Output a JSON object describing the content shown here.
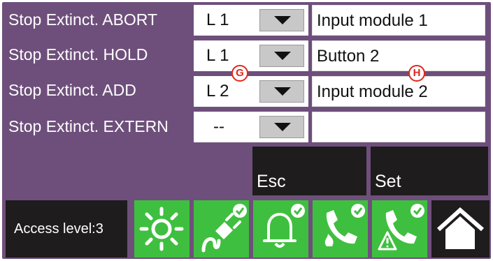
{
  "rows": [
    {
      "label": "Stop Extinct. ABORT",
      "value": "L 1",
      "description": "Input module 1"
    },
    {
      "label": "Stop Extinct. HOLD",
      "value": "L 1",
      "description": "Button 2"
    },
    {
      "label": "Stop Extinct. ADD",
      "value": "L 2",
      "description": "Input module 2"
    },
    {
      "label": "Stop Extinct. EXTERN",
      "value": "--",
      "description": ""
    }
  ],
  "markers": {
    "g": "G",
    "h": "H"
  },
  "buttons": {
    "esc": "Esc",
    "set": "Set"
  },
  "footer": {
    "access_level": "Access level:3"
  },
  "status_icons": [
    "sun-icon",
    "power-plug-icon",
    "bell-icon",
    "phone-fire-icon",
    "phone-warning-icon",
    "home-icon"
  ],
  "colors": {
    "panel": "#6e4f7b",
    "status_green": "#3fbf3f",
    "dark": "#1f1c1d",
    "marker_red": "#e1261c"
  }
}
